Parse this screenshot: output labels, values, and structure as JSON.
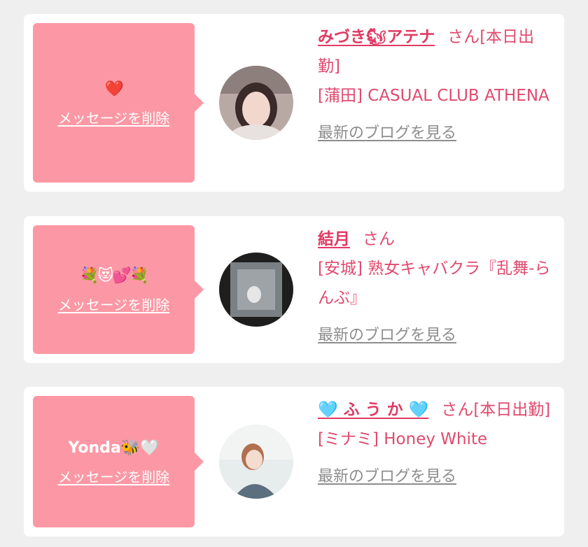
{
  "messages": [
    {
      "bubble_text": "❤️",
      "delete_label": "メッセージを削除",
      "name": "みづき🐿アテナ",
      "suffix": "さん[本日出勤]",
      "shop": "[蒲田] CASUAL CLUB ATHENA",
      "blog_label": "最新のブログを見る"
    },
    {
      "bubble_text": "💐😻💕💐",
      "delete_label": "メッセージを削除",
      "name": "結月",
      "suffix": "さん",
      "shop": "[安城] 熟女キャバクラ『乱舞-らんぶ』",
      "blog_label": "最新のブログを見る"
    },
    {
      "bubble_text": "Yonda🐝🤍",
      "delete_label": "メッセージを削除",
      "name": "🩵 ふ う か 🩵",
      "suffix": "さん[本日出勤]",
      "shop": "[ミナミ] Honey White",
      "blog_label": "最新のブログを見る"
    }
  ],
  "colors": {
    "background": "#efefef",
    "card": "#ffffff",
    "bubble": "#fc98a5",
    "name": "#e03a63",
    "text": "#e04a6e",
    "blog_link": "#8d8d8d"
  }
}
